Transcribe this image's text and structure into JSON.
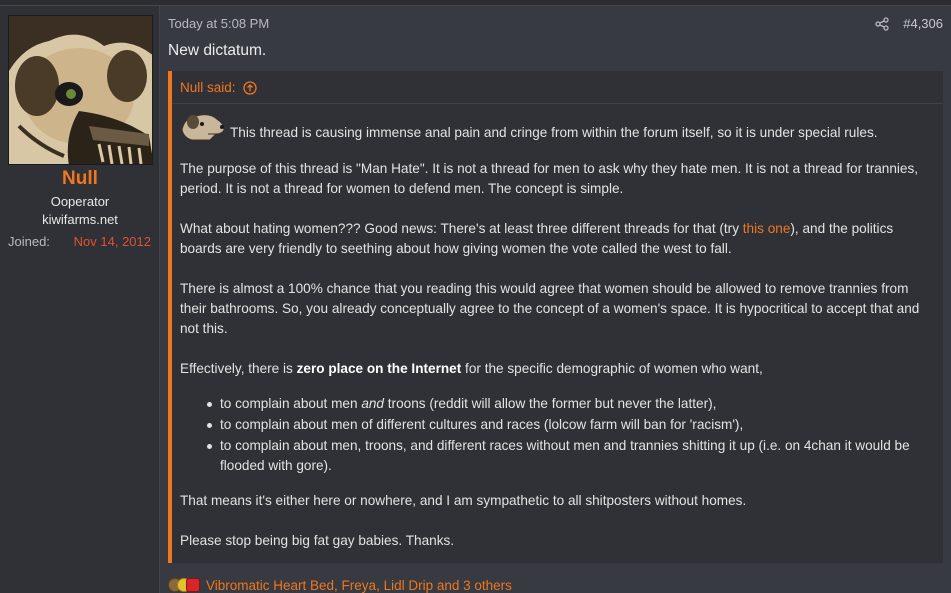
{
  "user": {
    "name": "Null",
    "title": "Ooperator",
    "banner": "kiwifarms.net",
    "joined_label": "Joined:",
    "joined_value": "Nov 14, 2012"
  },
  "post": {
    "time": "Today at 5:08 PM",
    "number": "#4,306",
    "first_line": "New dictatum."
  },
  "quote": {
    "author_label": "Null said:",
    "p1": "This thread is causing immense anal pain and cringe from within the forum itself, so it is under special rules.",
    "p2": "The purpose of this thread is \"Man Hate\". It is not a thread for men to ask why they hate men. It is not a thread for trannies, period. It is not a thread for women to defend men. The concept is simple.",
    "p3_before": "What about hating women??? Good news: There's at least three different threads for that (try ",
    "p3_link": "this one",
    "p3_after": "), and the politics boards are very friendly to seething about how giving women the vote called the west to fall.",
    "p4": "There is almost a 100% chance that you reading this would agree that women should be allowed to remove trannies from their bathrooms. So, you already conceptually agree to the concept of a women's space. It is hypocritical to accept that and not this.",
    "p5_before": "Effectively, there is ",
    "p5_bold": "zero place on the Internet",
    "p5_after": " for the specific demographic of women who want,",
    "li1_before": "to complain about men ",
    "li1_em": "and",
    "li1_after": " troons (reddit will allow the former but never the latter),",
    "li2": "to complain about men of different cultures and races (lolcow farm will ban for 'racism'),",
    "li3": "to complain about men, troons, and different races without men and trannies shitting it up (i.e. on 4chan it would be flooded with gore).",
    "p6": "That means it's either here or nowhere, and I am sympathetic to all shitposters without homes.",
    "p7": "Please stop being big fat gay babies. Thanks."
  },
  "reactions": {
    "list": "Vibromatic Heart Bed, Freya, Lidl Drip and 3 others",
    "icons": [
      "dog-reaction-icon",
      "lemon-reaction-icon",
      "heart-reaction-icon"
    ]
  },
  "colors": {
    "accent": "#f0761f",
    "joined_date": "#e0522e",
    "background": "#373a40",
    "panel": "#2f3136"
  }
}
